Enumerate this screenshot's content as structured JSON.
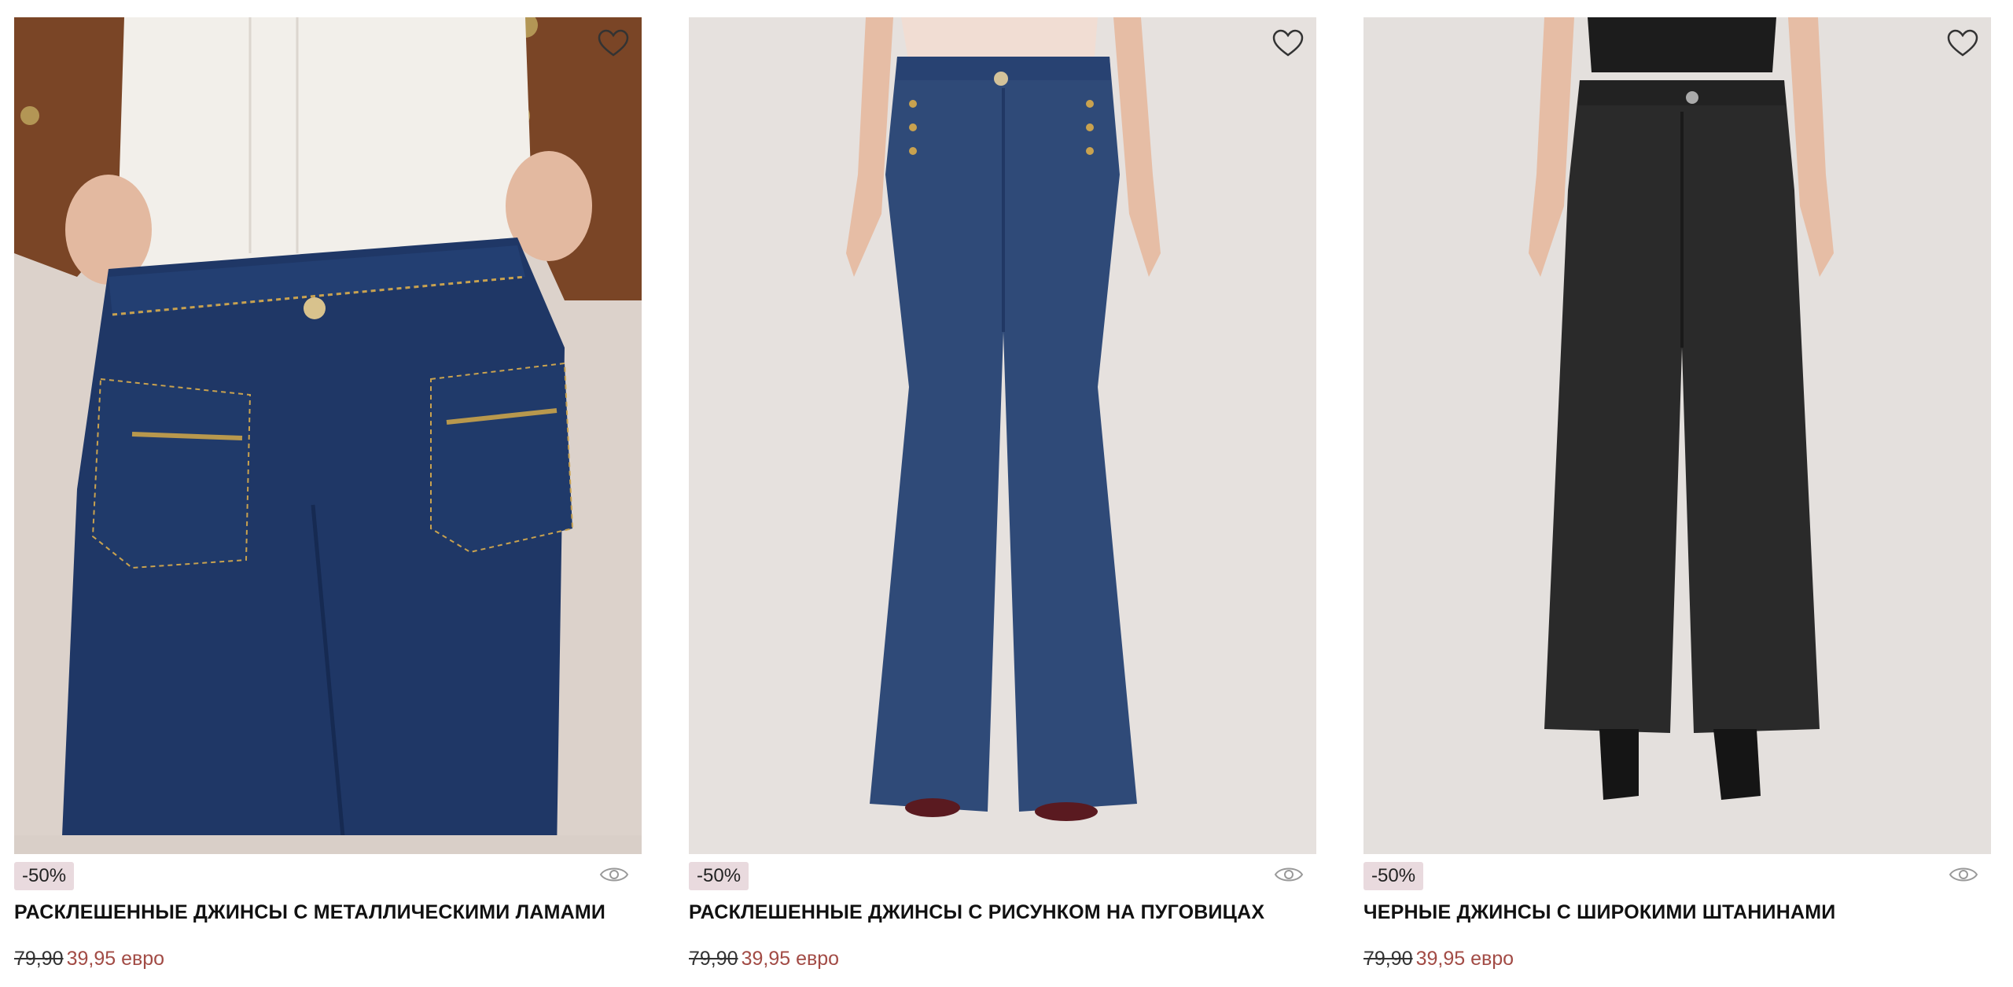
{
  "products": [
    {
      "discount": "-50%",
      "title": "РАСКЛЕШЕННЫЕ ДЖИНСЫ С МЕТАЛЛИЧЕСКИМИ ЛАМАМИ",
      "old_price": "79,90",
      "new_price": "39,95 евро",
      "swatch_color": "#2b4283"
    },
    {
      "discount": "-50%",
      "title": "РАСКЛЕШЕННЫЕ ДЖИНСЫ С РИСУНКОМ НА ПУГОВИЦАХ",
      "old_price": "79,90",
      "new_price": "39,95 евро",
      "swatch_color": "#2b4283"
    },
    {
      "discount": "-50%",
      "title": "ЧЕРНЫЕ ДЖИНСЫ С ШИРОКИМИ ШТАНИНАМИ",
      "old_price": "79,90",
      "new_price": "39,95 евро",
      "swatch_color": "#000000"
    }
  ],
  "icons": {
    "favorite": "heart-icon",
    "quick_view": "eye-icon"
  },
  "colors": {
    "badge_bg": "#e9dade",
    "sale_price": "#a24b45",
    "denim_dark_blue": "#1f3766",
    "denim_mid_blue": "#2f4a78",
    "denim_black": "#2a2a2a"
  }
}
